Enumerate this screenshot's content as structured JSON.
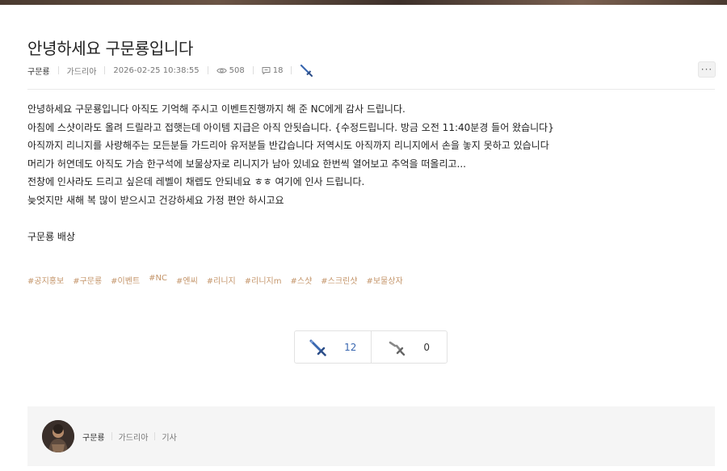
{
  "post": {
    "title": "안녕하세요 구문룡입니다",
    "author": "구문룡",
    "server": "가드리아",
    "datetime": "2026-02-25 10:38:55",
    "views": "508",
    "comments": "18"
  },
  "more_label": "···",
  "body_lines": [
    "안녕하세요  구문룡입니다   아직도 기억해 주시고 이벤트진행까지 해 준 NC에게 감사 드립니다.",
    "아침에 스샷이라도 올려 드릴라고 접햇는데 아이템 지급은 아직 안됫습니다.  {수정드립니다.  방금 오전 11:40분경 들어 왔습니다}",
    "아직까지 리니지를 사랑해주는 모든분들  가드리아 유저분들 반갑습니다    저역시도 아직까지 리니지에서 손을 놓지 못하고 있습니다",
    "머리가 허연데도 아직도 가슴 한구석에 보물상자로 리니지가 남아 있네요   한번씩 열어보고 추억을 떠올리고...",
    "전창에 인사라도 드리고 싶은데 레벨이 채렙도 안되네요  ㅎㅎ  여기에 인사 드립니다.",
    "늦엇지만 새해 복 많이 받으시고 건강하세요  가정 편안 하시고요"
  ],
  "signature": "구문룡 배상",
  "tags": [
    "#공지홍보",
    "#구문룡",
    "#이벤트",
    "#NC",
    "#엔씨",
    "#리니지",
    "#리니지m",
    "#스샷",
    "#스크린샷",
    "#보물상자"
  ],
  "votes": {
    "up": "12",
    "down": "0"
  },
  "author_card": {
    "name": "구문룡",
    "server": "가드리아",
    "role": "기사"
  },
  "colors": {
    "accent_blue": "#3a67b0",
    "tag_color": "#c4956a"
  }
}
